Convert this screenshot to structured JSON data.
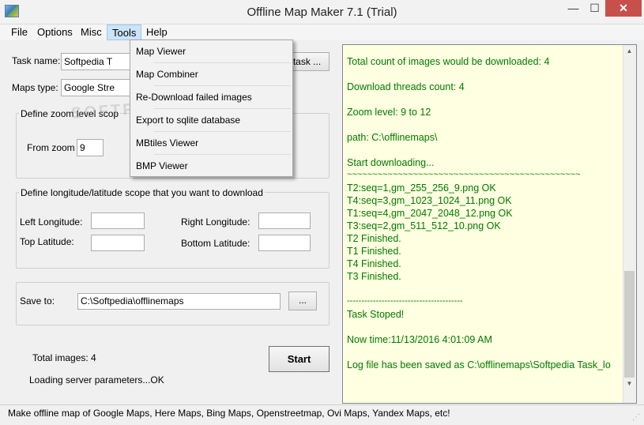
{
  "window": {
    "title": "Offline Map Maker 7.1 (Trial)",
    "minimize_label": "—",
    "maximize_label": "☐",
    "close_label": "✕",
    "app_icon": "map-globe-icon"
  },
  "menu": {
    "file": "File",
    "options": "Options",
    "misc": "Misc",
    "tools": "Tools",
    "help": "Help"
  },
  "tools_menu": {
    "items": [
      "Map Viewer",
      "Map Combiner",
      "Re-Download failed images",
      "Export to sqlite database",
      "MBtiles Viewer",
      "BMP Viewer"
    ]
  },
  "form": {
    "task_name_label": "Task name:",
    "task_name_value": "Softpedia T",
    "task_button_label": "task ...",
    "maps_type_label": "Maps type:",
    "maps_type_value": "Google Stre",
    "zoom_group_title": "Define zoom level scop",
    "from_zoom_label": "From zoom",
    "from_zoom_value": "9",
    "lonlat_group_title": "Define longitude/latitude scope that you want to download",
    "left_longitude_label": "Left Longitude:",
    "right_longitude_label": "Right Longitude:",
    "top_latitude_label": "Top Latitude:",
    "bottom_latitude_label": "Bottom Latitude:",
    "left_longitude_value": "",
    "right_longitude_value": "",
    "top_latitude_value": "",
    "bottom_latitude_value": "",
    "save_to_label": "Save to:",
    "save_to_value": "C:\\Softpedia\\offlinemaps",
    "browse_label": "...",
    "total_images": "Total images:  4",
    "loading_status": "Loading server parameters...OK",
    "start_label": "Start"
  },
  "log": {
    "lines": [
      "Total count of images would be downloaded: 4",
      "Download threads count: 4",
      "Zoom level: 9 to 12",
      "path: C:\\offlinemaps\\",
      "Start downloading...",
      "~~~~~~~~~~~~~~~~~~~~~~~~~~~~~~~~~~~~~~~~~~~~~~",
      "T2:seq=1,gm_255_256_9.png OK",
      "T4:seq=3,gm_1023_1024_11.png OK",
      "T1:seq=4,gm_2047_2048_12.png OK",
      "T3:seq=2,gm_511_512_10.png OK",
      "T2 Finished.",
      "T1 Finished.",
      "T4 Finished.",
      "T3 Finished.",
      "----------------------------------------",
      "Task Stoped!",
      "Now time:11/13/2016 4:01:09 AM",
      "Log file has been saved as C:\\offlinemaps\\Softpedia Task_lo"
    ]
  },
  "status_bar": {
    "text": "Make offline map of Google Maps, Here Maps, Bing Maps, Openstreetmap, Ovi Maps, Yandex Maps,  etc!"
  },
  "colors": {
    "log_text": "#007a00",
    "log_background": "#ffffe1",
    "close_button": "#c7504b",
    "menu_highlight": "#cce4f7"
  }
}
